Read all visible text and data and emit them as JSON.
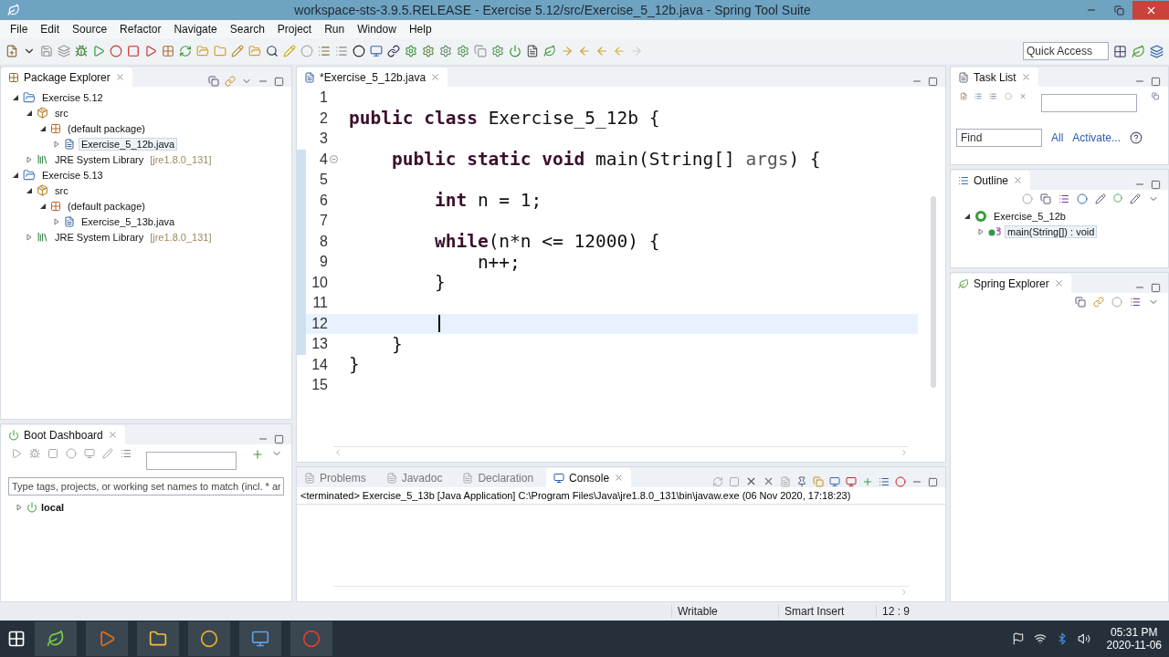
{
  "window": {
    "title": "workspace-sts-3.9.5.RELEASE - Exercise 5.12/src/Exercise_5_12b.java - Spring Tool Suite"
  },
  "menu": [
    "File",
    "Edit",
    "Source",
    "Refactor",
    "Navigate",
    "Search",
    "Project",
    "Run",
    "Window",
    "Help"
  ],
  "quick_access": {
    "placeholder": "Quick Access"
  },
  "package_explorer": {
    "title": "Package Explorer",
    "tree": [
      {
        "label": "Exercise 5.12",
        "kind": "project",
        "expanded": true,
        "selected": false,
        "children": [
          {
            "label": "src",
            "kind": "folder",
            "expanded": true,
            "selected": false,
            "children": [
              {
                "label": "(default package)",
                "kind": "package",
                "expanded": true,
                "selected": false,
                "children": [
                  {
                    "label": "Exercise_5_12b.java",
                    "kind": "file",
                    "expanded": false,
                    "selected": true
                  }
                ]
              }
            ]
          },
          {
            "label": "JRE System Library",
            "suffix": "[jre1.8.0_131]",
            "kind": "library",
            "expanded": false,
            "selected": false
          }
        ]
      },
      {
        "label": "Exercise 5.13",
        "kind": "project",
        "expanded": true,
        "selected": false,
        "children": [
          {
            "label": "src",
            "kind": "folder",
            "expanded": true,
            "selected": false,
            "children": [
              {
                "label": "(default package)",
                "kind": "package",
                "expanded": true,
                "selected": false,
                "children": [
                  {
                    "label": "Exercise_5_13b.java",
                    "kind": "file",
                    "expanded": false,
                    "selected": false
                  }
                ]
              }
            ]
          },
          {
            "label": "JRE System Library",
            "suffix": "[jre1.8.0_131]",
            "kind": "library",
            "expanded": false,
            "selected": false
          }
        ]
      }
    ]
  },
  "boot_dashboard": {
    "title": "Boot Dashboard",
    "filter": {
      "placeholder": "Type tags, projects, or working set names to match (incl. * ar"
    },
    "items": [
      {
        "label": "local",
        "expanded": false
      }
    ]
  },
  "editor": {
    "tab": "*Exercise_5_12b.java",
    "lines": [
      {
        "number": "1"
      },
      {
        "number": "2",
        "tokens": [
          {
            "text": "public class ",
            "kind": "keyword"
          },
          {
            "text": "Exercise_5_12b {",
            "kind": "plain"
          }
        ]
      },
      {
        "number": "3"
      },
      {
        "number": "4",
        "changed": true,
        "foldable": true,
        "tokens": [
          {
            "text": "    public static void ",
            "kind": "keyword"
          },
          {
            "text": "main(String[] ",
            "kind": "plain"
          },
          {
            "text": "args",
            "kind": "param"
          },
          {
            "text": ") {",
            "kind": "plain"
          }
        ]
      },
      {
        "number": "5",
        "changed": true
      },
      {
        "number": "6",
        "changed": true,
        "tokens": [
          {
            "text": "        int ",
            "kind": "keyword"
          },
          {
            "text": "n = 1;",
            "kind": "plain"
          }
        ]
      },
      {
        "number": "7",
        "changed": true
      },
      {
        "number": "8",
        "changed": true,
        "tokens": [
          {
            "text": "        while",
            "kind": "keyword"
          },
          {
            "text": "(n*n <= 12000) {",
            "kind": "plain"
          }
        ]
      },
      {
        "number": "9",
        "changed": true,
        "tokens": [
          {
            "text": "            n++;",
            "kind": "plain"
          }
        ]
      },
      {
        "number": "10",
        "changed": true,
        "tokens": [
          {
            "text": "        }",
            "kind": "plain"
          }
        ]
      },
      {
        "number": "11",
        "changed": true
      },
      {
        "number": "12",
        "changed": true,
        "current": true
      },
      {
        "number": "13",
        "changed": true,
        "tokens": [
          {
            "text": "    }",
            "kind": "plain"
          }
        ]
      },
      {
        "number": "14",
        "tokens": [
          {
            "text": "}",
            "kind": "plain"
          }
        ]
      },
      {
        "number": "15"
      }
    ]
  },
  "console": {
    "tabs": [
      {
        "label": "Problems",
        "selected": false
      },
      {
        "label": "Javadoc",
        "selected": false
      },
      {
        "label": "Declaration",
        "selected": false
      },
      {
        "label": "Console",
        "selected": true
      }
    ],
    "text": "<terminated> Exercise_5_13b [Java Application] C:\\Program Files\\Java\\jre1.8.0_131\\bin\\javaw.exe (06 Nov 2020, 17:18:23)"
  },
  "task_list": {
    "title": "Task List",
    "find": {
      "placeholder": "Find"
    },
    "links": [
      "All",
      "Activate..."
    ]
  },
  "outline": {
    "title": "Outline",
    "tree": [
      {
        "label": "Exercise_5_12b",
        "kind": "class",
        "expanded": true,
        "selected": false,
        "children": [
          {
            "label": "main(String[]) : void",
            "kind": "method",
            "expanded": false,
            "selected": true
          }
        ]
      }
    ]
  },
  "spring_explorer": {
    "title": "Spring Explorer"
  },
  "status_bar": [
    "Writable",
    "Smart Insert",
    "12 : 9"
  ],
  "taskbar": {
    "time": "05:31 PM",
    "date": "2020-11-06"
  }
}
